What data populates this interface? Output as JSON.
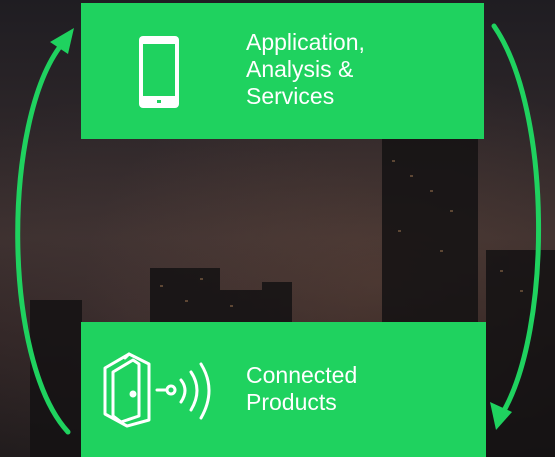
{
  "diagram": {
    "top_box": {
      "label": "Application,\nAnalysis &\nServices",
      "icon": "smartphone-icon"
    },
    "bottom_box": {
      "label": "Connected\nProducts",
      "icon": "connected-door-icon"
    },
    "arrows": [
      "left-upward-arrow",
      "right-downward-arrow"
    ],
    "colors": {
      "box": "#1fd25f",
      "arrow": "#1fd25f",
      "icon": "#ffffff",
      "text": "#ffffff"
    }
  }
}
